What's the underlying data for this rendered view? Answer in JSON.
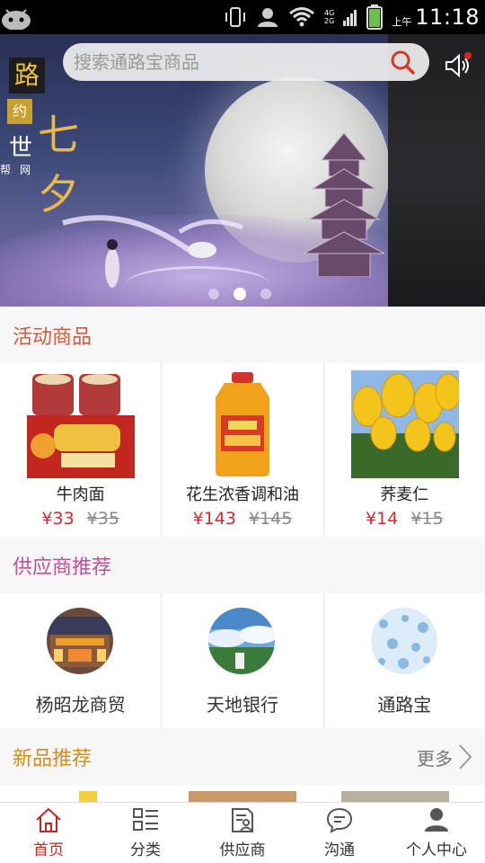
{
  "status_bar": {
    "time": "11:18",
    "ampm": "上午",
    "network": [
      "4G",
      "2G"
    ]
  },
  "banner": {
    "logo_chars": [
      "路",
      "约",
      "世",
      "七夕",
      "帮",
      "网"
    ],
    "search_placeholder": "搜索通路宝商品",
    "carousel": {
      "count": 3,
      "active_index": 1
    }
  },
  "sections": {
    "activity": {
      "title": "活动商品",
      "color": "#d65a3a"
    },
    "suppliers": {
      "title": "供应商推荐",
      "color": "#c0509a"
    },
    "new": {
      "title": "新品推荐",
      "color": "#d98a1a",
      "more_label": "更多"
    }
  },
  "products": [
    {
      "name": "牛肉面",
      "price": "¥33",
      "original_price": "¥35"
    },
    {
      "name": "花生浓香调和油",
      "price": "¥143",
      "original_price": "¥145"
    },
    {
      "name": "荞麦仁",
      "price": "¥14",
      "original_price": "¥15"
    }
  ],
  "suppliers": [
    {
      "name": "杨昭龙商贸"
    },
    {
      "name": "天地银行"
    },
    {
      "name": "通路宝"
    }
  ],
  "tabs": [
    {
      "label": "首页",
      "icon": "home-icon",
      "active": true
    },
    {
      "label": "分类",
      "icon": "category-icon",
      "active": false
    },
    {
      "label": "供应商",
      "icon": "supplier-icon",
      "active": false
    },
    {
      "label": "沟通",
      "icon": "chat-icon",
      "active": false
    },
    {
      "label": "个人中心",
      "icon": "user-icon",
      "active": false
    }
  ],
  "colors": {
    "accent": "#c6261e",
    "price": "#d52a2a"
  }
}
